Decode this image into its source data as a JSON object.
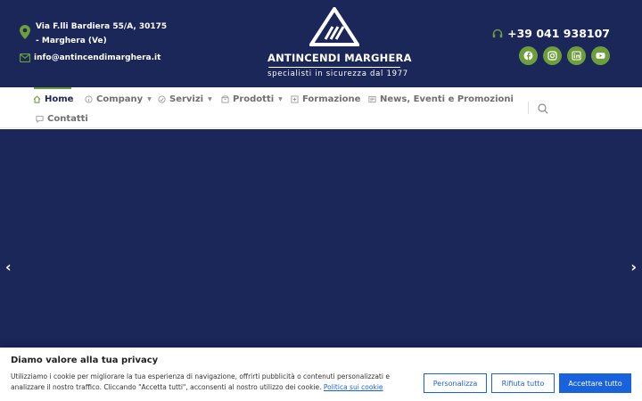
{
  "header": {
    "address": "Via F.lli Bardiera 55/A, 30175 - Marghera (Ve)",
    "email": "info@antincendimarghera.it",
    "phone": "+39 041 938107",
    "logo_brand": "ANTINCENDI MARGHERA",
    "logo_tagline": "specialisti in sicurezza dal 1977",
    "social_icons": [
      "facebook-icon",
      "instagram-icon",
      "linkedin-icon",
      "youtube-icon"
    ]
  },
  "nav": {
    "items": [
      {
        "label": "Home",
        "icon": "home-icon",
        "active": true
      },
      {
        "label": "Company",
        "icon": "info-icon",
        "dropdown": true
      },
      {
        "label": "Servizi",
        "icon": "services-icon",
        "dropdown": true
      },
      {
        "label": "Prodotti",
        "icon": "box-icon",
        "dropdown": true
      },
      {
        "label": "Formazione",
        "icon": "plus-square-icon"
      },
      {
        "label": "News, Eventi e Promozioni",
        "icon": "newspaper-icon"
      },
      {
        "label": "Contatti",
        "icon": "chat-icon"
      }
    ]
  },
  "hero": {
    "prev_label": "‹",
    "next_label": "›"
  },
  "cookie": {
    "title": "Diamo valore alla tua privacy",
    "text": "Utilizziamo i cookie per migliorare la tua esperienza di navigazione, offrirti pubblicità o contenuti personalizzati e analizzare il nostro traffico. Cliccando \"Accetta tutti\", acconsenti al nostro utilizzo dei cookie.",
    "policy_link": "Politica sui cookie",
    "customize_label": "Personalizza",
    "reject_label": "Rifiuta tutto",
    "accept_label": "Accettare tutto"
  },
  "colors": {
    "navy": "#1b2659",
    "green": "#6e9e3b",
    "cookie_blue": "#1863dc"
  }
}
